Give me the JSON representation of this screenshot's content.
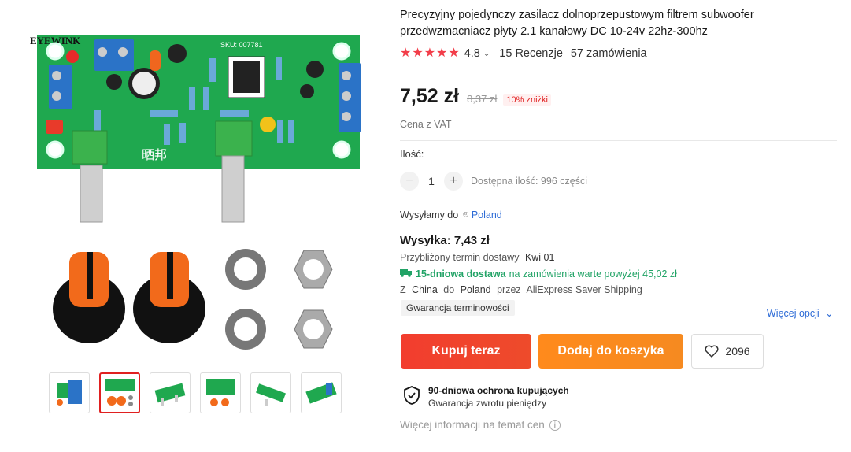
{
  "product": {
    "title": "Precyzyjny pojedynczy zasilacz dolnoprzepustowym filtrem subwoofer przedwzmacniacz płyty 2.1 kanałowy DC 10-24v 22hz-300hz",
    "rating": "4.8",
    "reviews": "15 Recenzje",
    "orders": "57 zamówienia",
    "price": "7,52 zł",
    "old_price": "8,37 zł",
    "discount": "10% zniżki",
    "vat_note": "Cena z VAT"
  },
  "gallery": {
    "brand_text": "EYEWINK",
    "sku": "SKU: 007781",
    "brand_chinese": "晒邦",
    "thumbnail_count": 6,
    "active_thumbnail": 2
  },
  "quantity": {
    "label": "Ilość:",
    "value": "1",
    "minus": "−",
    "plus": "+",
    "available": "Dostępna ilość: 996 części"
  },
  "shipping": {
    "ship_to_label": "Wysyłamy do",
    "country": "Poland",
    "cost": "Wysyłka: 7,43 zł",
    "eta_label": "Przybliżony termin dostawy",
    "eta_value": "Kwi 01",
    "fast_bold": "15-dniowa dostawa",
    "fast_rest": "na zamówienia warte powyżej 45,02 zł",
    "from_label": "Z",
    "from": "China",
    "to_label": "do",
    "to": "Poland",
    "via_label": "przez",
    "method": "AliExpress Saver Shipping",
    "guarantee": "Gwarancja terminowości",
    "more_options": "Więcej opcji"
  },
  "actions": {
    "buy_now": "Kupuj teraz",
    "add_to_cart": "Dodaj do koszyka",
    "wishlist_count": "2096"
  },
  "protection": {
    "title": "90-dniowa ochrona kupujących",
    "subtitle": "Gwarancja zwrotu pieniędzy"
  },
  "more_info": "Więcej informacji na temat cen",
  "colors": {
    "accent_red": "#f23d49",
    "buy_button": "#f23d2e",
    "cart_button": "#f68a20",
    "link_blue": "#2d6bd6",
    "fast_green": "#21a366"
  }
}
